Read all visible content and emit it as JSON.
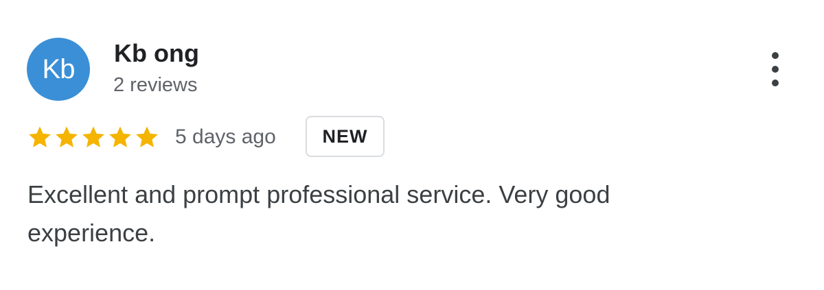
{
  "review": {
    "avatar_initials": "Kb",
    "author_name": "Kb ong",
    "author_reviews": "2 reviews",
    "rating": 5,
    "rating_max": 5,
    "date": "5 days ago",
    "badge": "NEW",
    "text": "Excellent and prompt professional service. Very good experience."
  },
  "colors": {
    "avatar_bg": "#3a8fd6",
    "star": "#f4b400",
    "text": "#3c4043",
    "muted": "#5f6368"
  },
  "icons": {
    "star": "star-icon",
    "more": "more-vert-icon"
  }
}
